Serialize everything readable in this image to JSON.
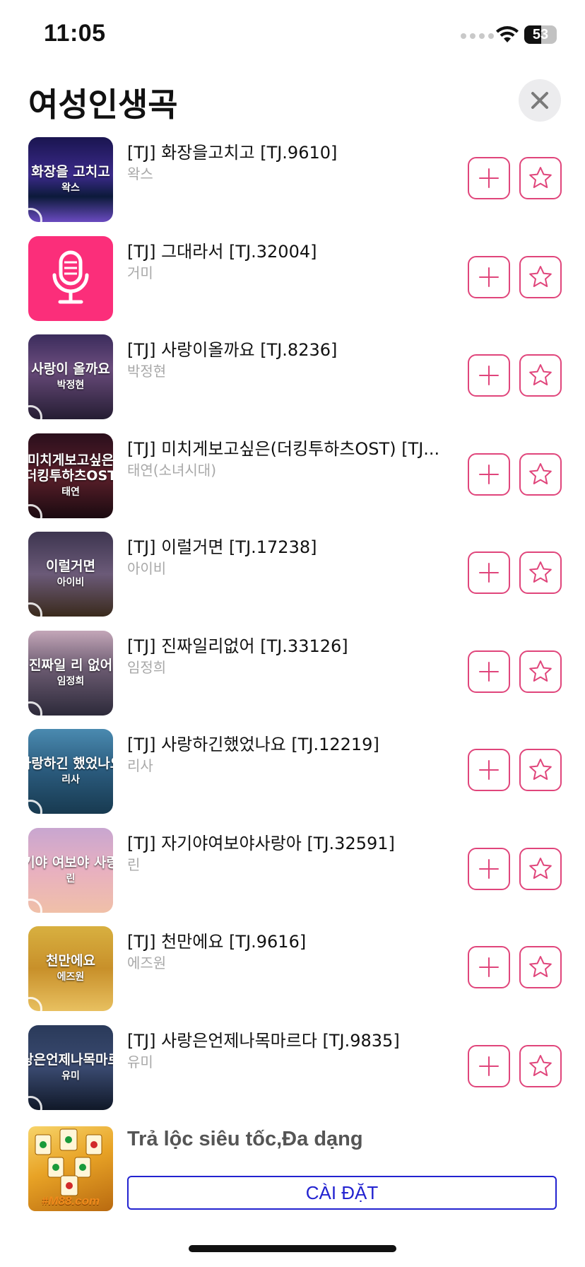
{
  "status_bar": {
    "time": "11:05",
    "battery": "53",
    "battery_level_percent": 53
  },
  "header": {
    "title": "여성인생곡",
    "close_icon": "close-icon"
  },
  "colors": {
    "accent": "#e0457b",
    "ad_button": "#2323d0"
  },
  "songs": [
    {
      "title": "[TJ] 화장을고치고 [TJ.9610]",
      "artist": "왁스",
      "art_title": "화장을 고치고",
      "art_artist": "왁스"
    },
    {
      "title": "[TJ] 그대라서 [TJ.32004]",
      "artist": "거미",
      "art_title": "",
      "art_artist": "",
      "art_icon": "microphone-icon"
    },
    {
      "title": "[TJ] 사랑이올까요 [TJ.8236]",
      "artist": "박정현",
      "art_title": "사랑이 올까요",
      "art_artist": "박정현"
    },
    {
      "title": "[TJ] 미치게보고싶은(더킹투하츠OST) [TJ...",
      "artist": "태연(소녀시대)",
      "art_title": "미치게보고싶은",
      "art_title_2": "(더킹투하츠OST)",
      "art_artist": "태연"
    },
    {
      "title": "[TJ] 이럴거면 [TJ.17238]",
      "artist": "아이비",
      "art_title": "이럴거면",
      "art_artist": "아이비"
    },
    {
      "title": "[TJ] 진짜일리없어 [TJ.33126]",
      "artist": "임정희",
      "art_title": "진짜일 리 없어",
      "art_artist": "임정희"
    },
    {
      "title": "[TJ] 사랑하긴했었나요 [TJ.12219]",
      "artist": "리사",
      "art_title": "사랑하긴 했었나요",
      "art_artist": "리사"
    },
    {
      "title": "[TJ] 자기야여보야사랑아 [TJ.32591]",
      "artist": "린",
      "art_title": "기야 여보야 사랑",
      "art_artist": "린"
    },
    {
      "title": "[TJ] 천만에요 [TJ.9616]",
      "artist": "에즈원",
      "art_title": "천만에요",
      "art_artist": "에즈원"
    },
    {
      "title": "[TJ] 사랑은언제나목마르다 [TJ.9835]",
      "artist": "유미",
      "art_title": "랑은언제나목마르",
      "art_artist": "유미"
    }
  ],
  "ad": {
    "headline": "Trả lộc siêu tốc,Đa dạng",
    "cta": "CÀI ĐẶT",
    "logo_text": "#M88.com"
  }
}
